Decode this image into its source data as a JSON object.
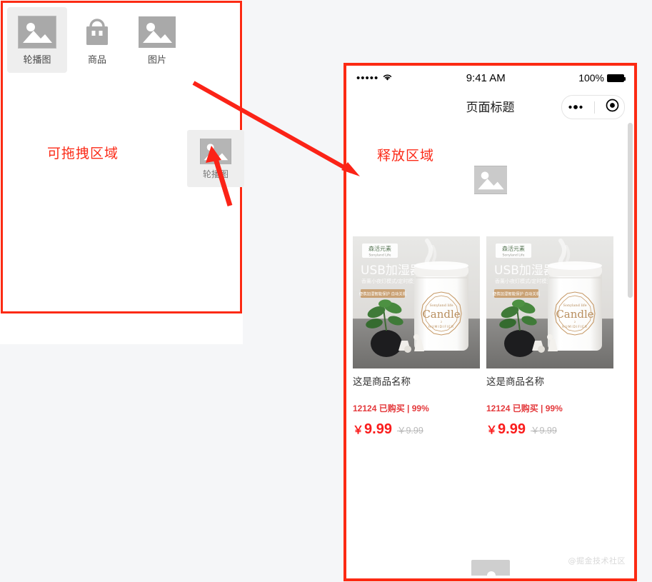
{
  "colors": {
    "accent_red": "#fc2a13",
    "hint_red": "#fb2b18",
    "price_red": "#fa1c1c",
    "meta_red": "#e4393c",
    "page_bg": "#f5f6f8",
    "panel_bg": "#ffffff",
    "selected_bg": "#eeeeee",
    "placeholder_gray": "#a9a9a9"
  },
  "left_panel": {
    "hint_label": "可拖拽区域",
    "palette": [
      {
        "label": "轮播图",
        "icon": "image-placeholder-icon",
        "selected": true
      },
      {
        "label": "商品",
        "icon": "shopping-bag-icon",
        "selected": false
      },
      {
        "label": "图片",
        "icon": "image-placeholder-icon",
        "selected": false
      }
    ],
    "drag_ghost": {
      "label": "轮播图",
      "icon": "image-placeholder-icon"
    }
  },
  "phone": {
    "statusbar": {
      "signal": "•••••",
      "wifi": "wifi-icon",
      "time": "9:41 AM",
      "battery_percent": "100%"
    },
    "navbar": {
      "title": "页面标题",
      "capsule": {
        "more": "ellipsis-icon",
        "target": "target-icon"
      }
    },
    "drop_hint": "释放区域",
    "banner_slot": {
      "icon": "image-placeholder-icon"
    },
    "goods": [
      {
        "name": "这是商品名称",
        "meta": "12124 已购买 | 99%",
        "price": "9.99",
        "price_symbol": "￥",
        "old_price": "￥9.99",
        "image": {
          "brand_cn": "森活元素",
          "brand_en": "Sonyland Life",
          "headline": "USB加湿器",
          "subline": "香薰小夜灯模式/定时模式",
          "tagline": "便携加湿智能保护 自动关机",
          "logo_script": "Sonyland life",
          "logo_main": "Candle",
          "logo_sub": "HUMIDIFIER"
        }
      },
      {
        "name": "这是商品名称",
        "meta": "12124 已购买 | 99%",
        "price": "9.99",
        "price_symbol": "￥",
        "old_price": "￥9.99",
        "image": {
          "brand_cn": "森活元素",
          "brand_en": "Sonyland Life",
          "headline": "USB加湿器",
          "subline": "香薰小夜灯模式/定时模式",
          "tagline": "便携加湿智能保护 自动关机",
          "logo_script": "Sonyland life",
          "logo_main": "Candle",
          "logo_sub": "HUMIDIFIER"
        }
      }
    ],
    "watermark": "@掘金技术社区"
  }
}
